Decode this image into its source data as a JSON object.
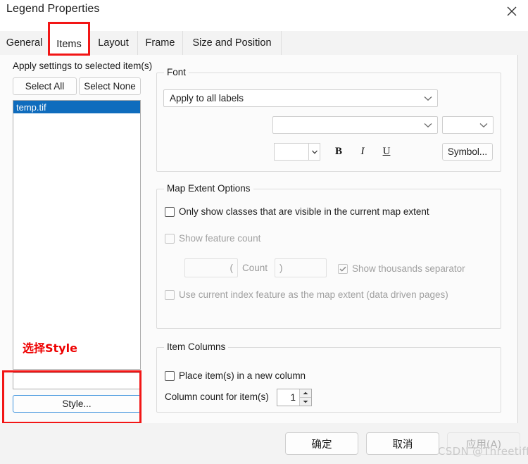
{
  "window": {
    "title": "Legend Properties",
    "close_icon": "close-icon"
  },
  "tabs": [
    {
      "label": "General",
      "active": false
    },
    {
      "label": "Items",
      "active": true
    },
    {
      "label": "Layout",
      "active": false
    },
    {
      "label": "Frame",
      "active": false
    },
    {
      "label": "Size and Position",
      "active": false
    }
  ],
  "left_panel": {
    "apply_label": "Apply settings to selected item(s)",
    "select_all_label": "Select All",
    "select_none_label": "Select None",
    "items": [
      {
        "label": "temp.tif",
        "selected": true
      }
    ],
    "style_input_value": "",
    "style_button_label": "Style..."
  },
  "annotation": {
    "text": "选择Style",
    "color": "#ee0000"
  },
  "font_group": {
    "title": "Font",
    "apply_scope_value": "Apply to all labels",
    "font_name_value": "",
    "font_style_value": "",
    "font_size_value": "",
    "bold_label": "B",
    "italic_label": "I",
    "underline_label": "U",
    "symbol_button_label": "Symbol..."
  },
  "map_extent_group": {
    "title": "Map Extent Options",
    "only_show_label": "Only show classes that are visible in the current map extent",
    "only_show_checked": false,
    "show_feature_count_label": "Show feature count",
    "show_feature_count_checked": false,
    "count_prefix_value": "(",
    "count_label": "Count",
    "count_suffix_value": ")",
    "show_thousands_label": "Show thousands separator",
    "show_thousands_checked": true,
    "index_feature_label": "Use current index feature as the map extent (data driven pages)",
    "index_feature_checked": false
  },
  "item_columns_group": {
    "title": "Item Columns",
    "new_column_label": "Place item(s) in a new column",
    "new_column_checked": false,
    "column_count_label": "Column count for item(s)",
    "column_count_value": "1"
  },
  "footer": {
    "ok_label": "确定",
    "cancel_label": "取消",
    "apply_label": "应用(A)"
  },
  "watermark": {
    "text": "CSDN @Threetiff"
  },
  "colors": {
    "selection_blue": "#0f6cbd",
    "annotation_red": "#ee0000",
    "marker_red": "#f21616",
    "focus_blue": "#3f93dd"
  }
}
